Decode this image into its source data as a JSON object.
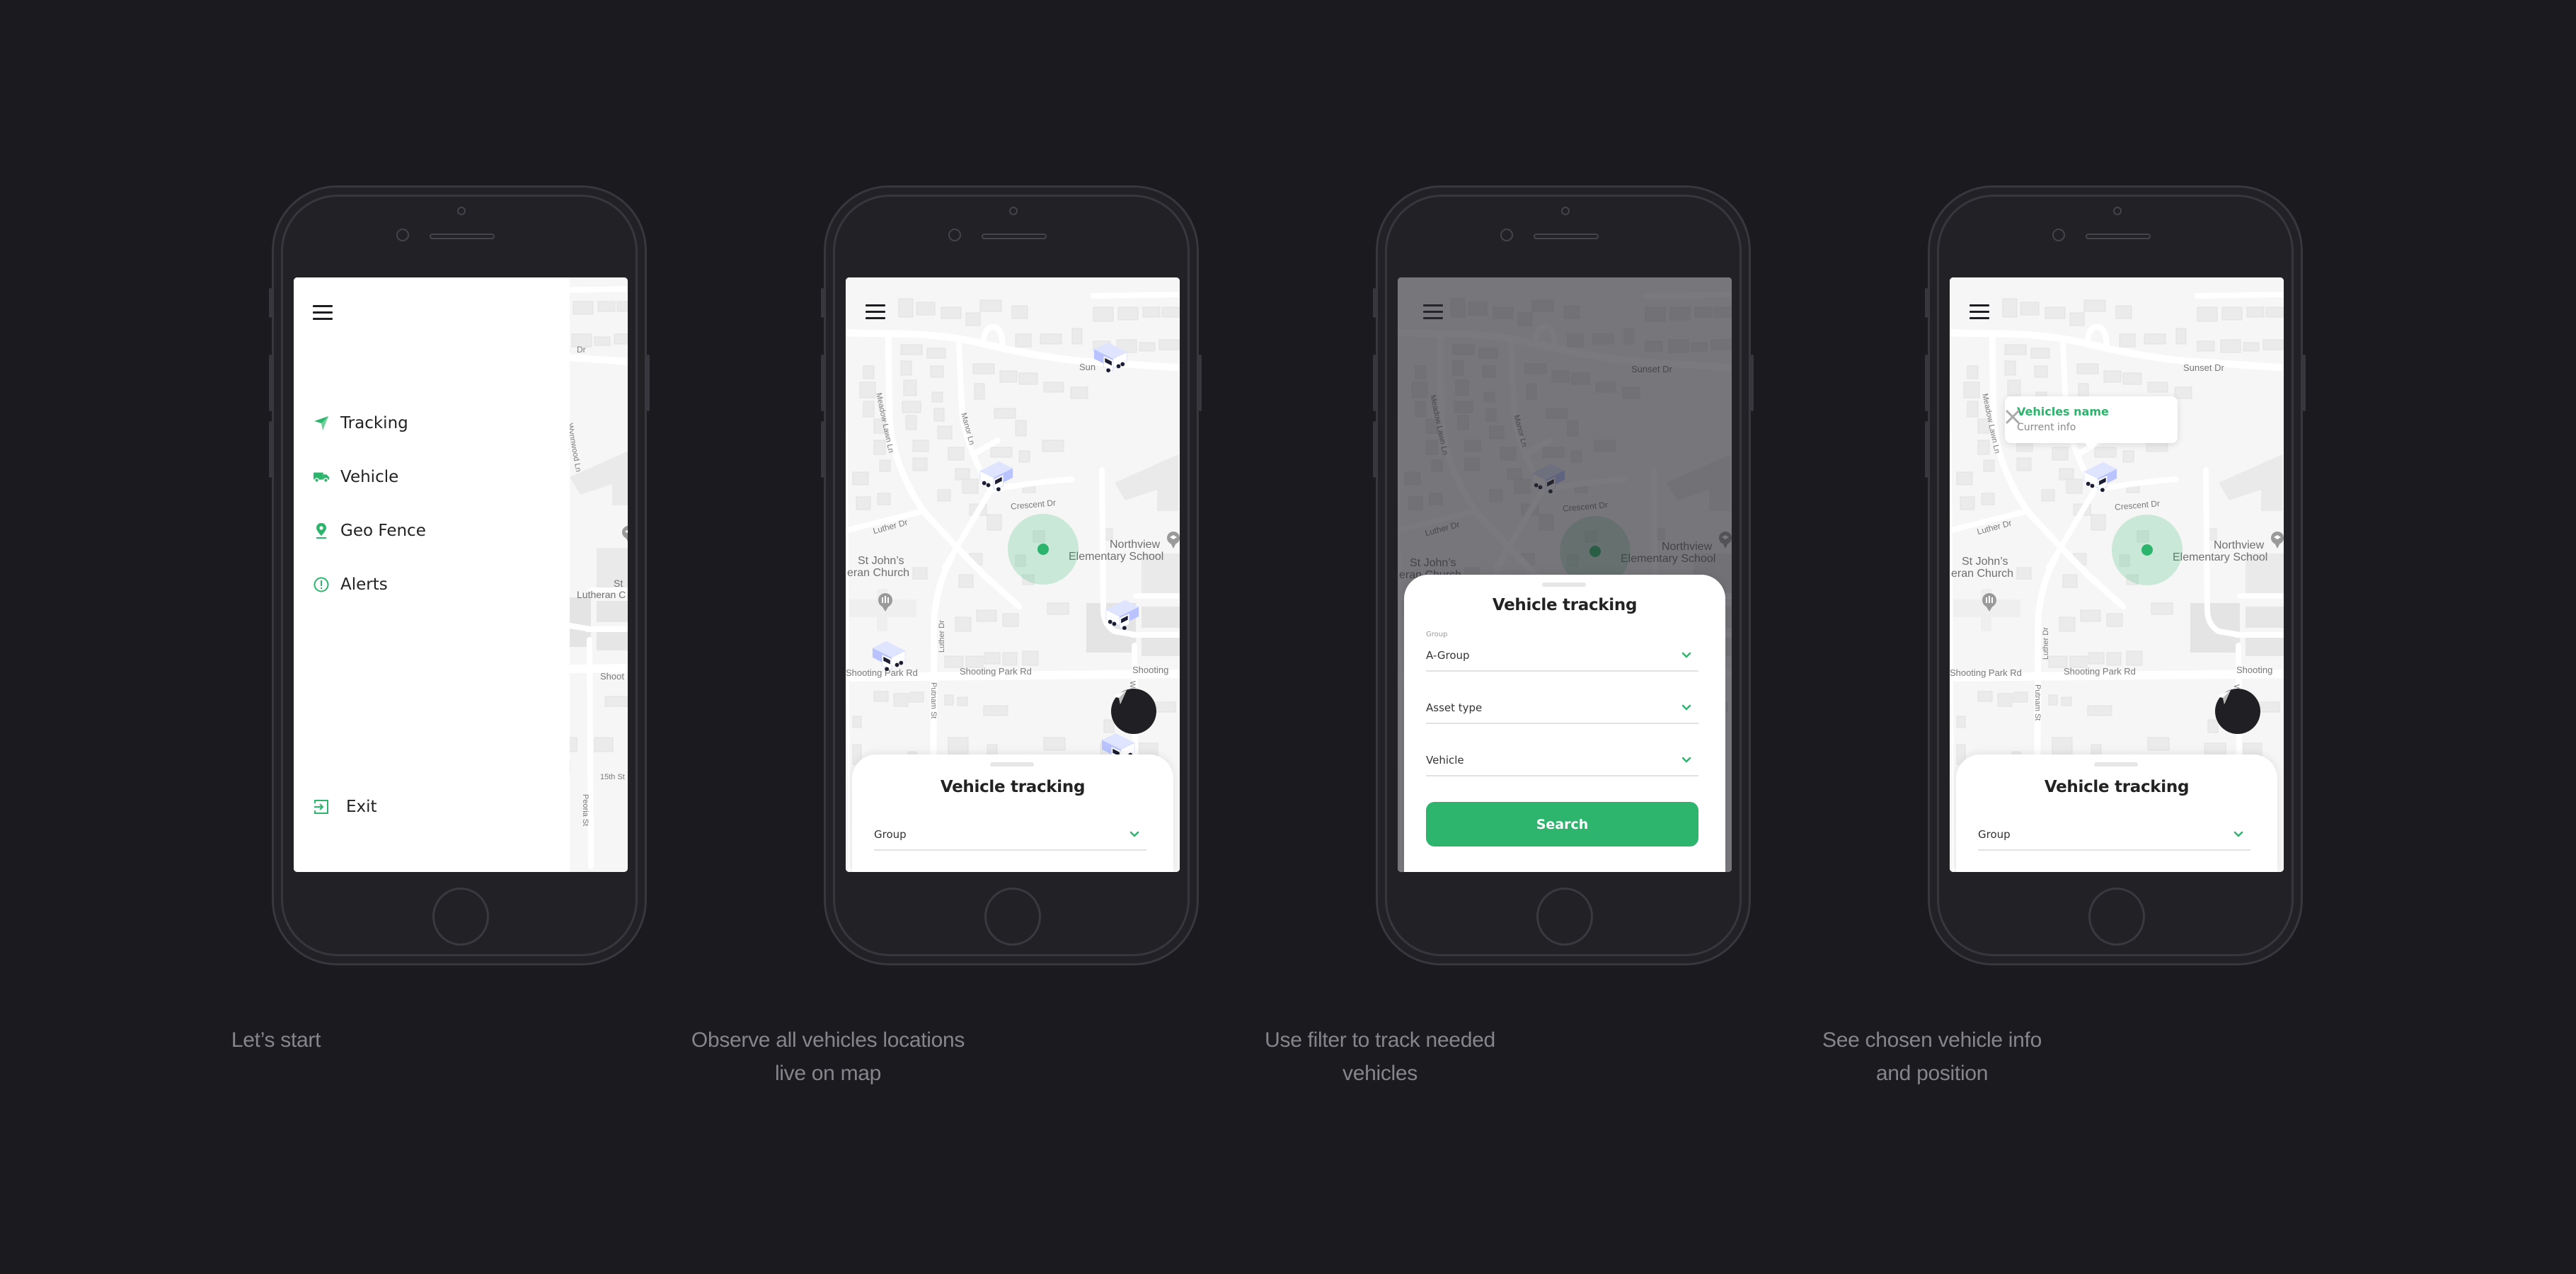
{
  "colors": {
    "background": "#1b1a1f",
    "accent": "#2db46d",
    "text_dark": "#222222",
    "caption": "#86858b"
  },
  "screens": [
    {
      "id": "menu",
      "caption_lines": [
        "Let’s start"
      ],
      "menu": {
        "items": [
          {
            "label": "Tracking",
            "icon": "navigation-arrow-icon"
          },
          {
            "label": "Vehicle",
            "icon": "truck-icon"
          },
          {
            "label": "Geo Fence",
            "icon": "map-pin-icon"
          },
          {
            "label": "Alerts",
            "icon": "alert-circle-icon"
          }
        ],
        "exit_label": "Exit",
        "exit_icon": "exit-icon"
      },
      "map_labels": [
        "Dr",
        "Wynnwood Ln",
        "St",
        "Lutheran C",
        "Shoot",
        "15th St",
        "Peoria St"
      ]
    },
    {
      "id": "map-all-vehicles",
      "caption_lines": [
        "Observe all vehicles locations",
        "live on map"
      ],
      "sheet": {
        "title": "Vehicle tracking",
        "fields": [
          {
            "label": "",
            "value": "Group"
          }
        ]
      },
      "vehicle_count_visible": 5,
      "map_labels": {
        "sunset": "Sun",
        "meadow": "Meadow Lawn Ln",
        "manor": "Manor Ln",
        "crescent": "Crescent Dr",
        "luther": "Luther Dr",
        "luther2": "Luther Dr",
        "church1": "St John’s",
        "church2": "eran Church",
        "school1": "Northview",
        "school2": "Elementary School",
        "shooting1": "Shooting Park Rd",
        "shooting2": "Shooting Park Rd",
        "shooting3": "Shooting",
        "putnam": "Putnam St",
        "west": "Wes"
      }
    },
    {
      "id": "filter",
      "caption_lines": [
        "Use filter to track needed",
        "vehicles"
      ],
      "sheet": {
        "title": "Vehicle tracking",
        "fields": [
          {
            "label": "Group",
            "value": "A-Group"
          },
          {
            "label": "",
            "value": "Asset type"
          },
          {
            "label": "",
            "value": "Vehicle"
          }
        ],
        "button_label": "Search"
      },
      "map_labels": {
        "sunset": "Sunset Dr",
        "meadow": "Meadow Lawn Ln",
        "manor": "Manor Ln",
        "crescent": "Crescent Dr",
        "luther": "Luther Dr",
        "church1": "St John’s",
        "church2": "eran Church",
        "school1": "Northview",
        "school2": "Elementary School"
      }
    },
    {
      "id": "vehicle-info",
      "caption_lines": [
        "See chosen vehicle info",
        "and position"
      ],
      "popup": {
        "name": "Vehicles name",
        "info": "Current info"
      },
      "sheet": {
        "title": "Vehicle tracking",
        "fields": [
          {
            "label": "",
            "value": "Group"
          }
        ]
      },
      "map_labels": {
        "sunset": "Sunset Dr",
        "meadow": "Meadow Lawn Ln",
        "crescent": "Crescent Dr",
        "luther": "Luther Dr",
        "luther2": "Luther Dr",
        "church1": "St John’s",
        "church2": "eran Church",
        "school1": "Northview",
        "school2": "Elementary School",
        "shooting1": "Shooting Park Rd",
        "shooting2": "Shooting Park Rd",
        "shooting3": "Shooting",
        "putnam": "Putnam St",
        "west": "Wes"
      }
    }
  ]
}
